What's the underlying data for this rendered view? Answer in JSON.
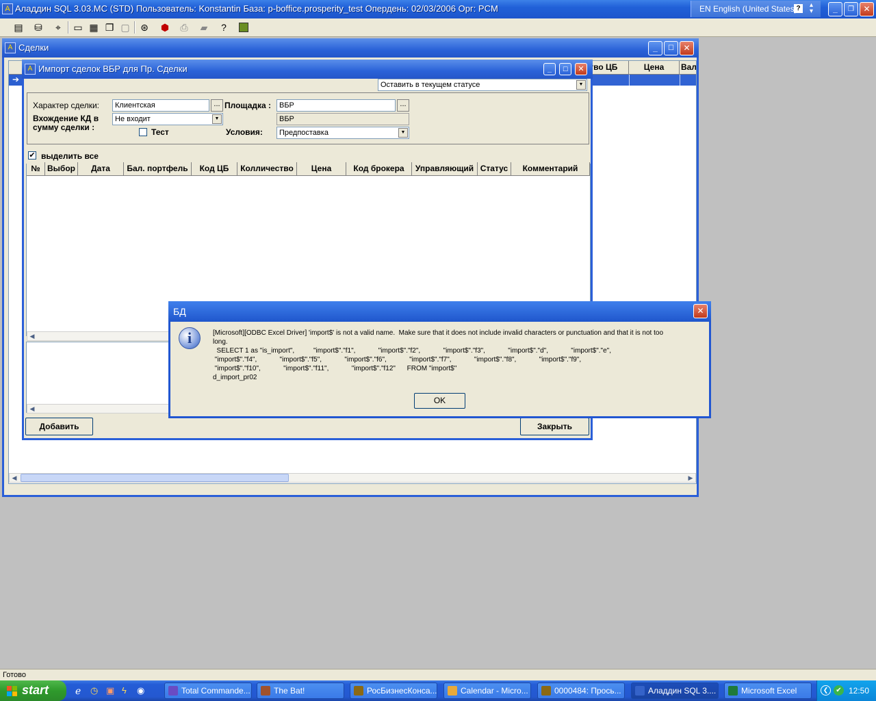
{
  "main_window": {
    "title": "Аладдин SQL 3.03.MC (STD)  Пользователь: Konstantin База: p-boffice.prosperity_test Опердень: 02/03/2006 Орг: PCM",
    "language": "EN English (United States)",
    "help": "?"
  },
  "toolbar_icons": [
    "list-icon",
    "database-icon",
    "filter-icon",
    "window-icon",
    "tile-icon",
    "cascade-icon",
    "minimize-all-icon",
    "binoculars-icon",
    "stop-icon",
    "print-icon",
    "export-icon",
    "help-icon",
    "exit-icon"
  ],
  "deals_window": {
    "title": "Сделки",
    "grid_headers": [
      "ство ЦБ",
      "Цена",
      "Вал"
    ]
  },
  "import_window": {
    "title": "Импорт сделок ВБР для Пр. Сделки",
    "status_select": "Оставить в текущем статусе",
    "deal_type_label": "Характер сделки:",
    "deal_type_value": "Клиентская",
    "ellipsis": "...",
    "platform_label": "Площадка :",
    "platform_value": "ВБР",
    "platform_name": "ВБР",
    "kd_label_1": "Вхождение КД в",
    "kd_label_2": "сумму сделки :",
    "kd_value": "Не входит",
    "test_label": "Тест",
    "conditions_label": "Условия:",
    "conditions_value": "Предпоставка",
    "select_all_label": "выделить все",
    "columns": [
      "№",
      "Выбор",
      "Дата",
      "Бал. портфель",
      "Код ЦБ",
      "Колличество",
      "Цена",
      "Код брокера",
      "Управляющий",
      "Статус",
      "Комментарий"
    ],
    "add_button": "Добавить",
    "close_button": "Закрыть"
  },
  "message_box": {
    "title": "БД",
    "line1": "[Microsoft][ODBC Excel Driver] 'import$' is not a valid name.  Make sure that it does not include invalid characters or punctuation and that it is not too",
    "line2": "long.",
    "line3": "  SELECT 1 as \"is_import\",          \"import$\".\"f1\",            \"import$\".\"f2\",            \"import$\".\"f3\",            \"import$\".\"d\",            \"import$\".\"e\",",
    "line4": " \"import$\".\"f4\",            \"import$\".\"f5\",            \"import$\".\"f6\",            \"import$\".\"f7\",            \"import$\".\"f8\",            \"import$\".\"f9\",",
    "line5": " \"import$\".\"f10\",            \"import$\".\"f11\",            \"import$\".\"f12\"      FROM \"import$\"",
    "line6": "d_import_pr02",
    "ok_label": "OK"
  },
  "status_bar": {
    "text": "Готово"
  },
  "taskbar": {
    "start_label": "start",
    "tasks": [
      "Total Commande...",
      "The Bat!",
      "РосБизнесКонса...",
      "Calendar - Micro...",
      "0000484: Прось...",
      "Аладдин SQL 3....",
      "Microsoft Excel"
    ],
    "clock": "12:50"
  }
}
